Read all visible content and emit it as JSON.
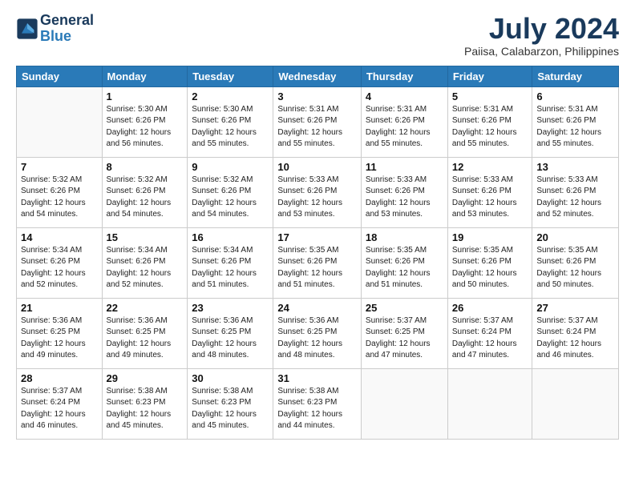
{
  "header": {
    "logo_line1": "General",
    "logo_line2": "Blue",
    "month": "July 2024",
    "location": "Paiisa, Calabarzon, Philippines"
  },
  "weekdays": [
    "Sunday",
    "Monday",
    "Tuesday",
    "Wednesday",
    "Thursday",
    "Friday",
    "Saturday"
  ],
  "weeks": [
    [
      {
        "day": "",
        "info": ""
      },
      {
        "day": "1",
        "info": "Sunrise: 5:30 AM\nSunset: 6:26 PM\nDaylight: 12 hours\nand 56 minutes."
      },
      {
        "day": "2",
        "info": "Sunrise: 5:30 AM\nSunset: 6:26 PM\nDaylight: 12 hours\nand 55 minutes."
      },
      {
        "day": "3",
        "info": "Sunrise: 5:31 AM\nSunset: 6:26 PM\nDaylight: 12 hours\nand 55 minutes."
      },
      {
        "day": "4",
        "info": "Sunrise: 5:31 AM\nSunset: 6:26 PM\nDaylight: 12 hours\nand 55 minutes."
      },
      {
        "day": "5",
        "info": "Sunrise: 5:31 AM\nSunset: 6:26 PM\nDaylight: 12 hours\nand 55 minutes."
      },
      {
        "day": "6",
        "info": "Sunrise: 5:31 AM\nSunset: 6:26 PM\nDaylight: 12 hours\nand 55 minutes."
      }
    ],
    [
      {
        "day": "7",
        "info": "Sunrise: 5:32 AM\nSunset: 6:26 PM\nDaylight: 12 hours\nand 54 minutes."
      },
      {
        "day": "8",
        "info": "Sunrise: 5:32 AM\nSunset: 6:26 PM\nDaylight: 12 hours\nand 54 minutes."
      },
      {
        "day": "9",
        "info": "Sunrise: 5:32 AM\nSunset: 6:26 PM\nDaylight: 12 hours\nand 54 minutes."
      },
      {
        "day": "10",
        "info": "Sunrise: 5:33 AM\nSunset: 6:26 PM\nDaylight: 12 hours\nand 53 minutes."
      },
      {
        "day": "11",
        "info": "Sunrise: 5:33 AM\nSunset: 6:26 PM\nDaylight: 12 hours\nand 53 minutes."
      },
      {
        "day": "12",
        "info": "Sunrise: 5:33 AM\nSunset: 6:26 PM\nDaylight: 12 hours\nand 53 minutes."
      },
      {
        "day": "13",
        "info": "Sunrise: 5:33 AM\nSunset: 6:26 PM\nDaylight: 12 hours\nand 52 minutes."
      }
    ],
    [
      {
        "day": "14",
        "info": "Sunrise: 5:34 AM\nSunset: 6:26 PM\nDaylight: 12 hours\nand 52 minutes."
      },
      {
        "day": "15",
        "info": "Sunrise: 5:34 AM\nSunset: 6:26 PM\nDaylight: 12 hours\nand 52 minutes."
      },
      {
        "day": "16",
        "info": "Sunrise: 5:34 AM\nSunset: 6:26 PM\nDaylight: 12 hours\nand 51 minutes."
      },
      {
        "day": "17",
        "info": "Sunrise: 5:35 AM\nSunset: 6:26 PM\nDaylight: 12 hours\nand 51 minutes."
      },
      {
        "day": "18",
        "info": "Sunrise: 5:35 AM\nSunset: 6:26 PM\nDaylight: 12 hours\nand 51 minutes."
      },
      {
        "day": "19",
        "info": "Sunrise: 5:35 AM\nSunset: 6:26 PM\nDaylight: 12 hours\nand 50 minutes."
      },
      {
        "day": "20",
        "info": "Sunrise: 5:35 AM\nSunset: 6:26 PM\nDaylight: 12 hours\nand 50 minutes."
      }
    ],
    [
      {
        "day": "21",
        "info": "Sunrise: 5:36 AM\nSunset: 6:25 PM\nDaylight: 12 hours\nand 49 minutes."
      },
      {
        "day": "22",
        "info": "Sunrise: 5:36 AM\nSunset: 6:25 PM\nDaylight: 12 hours\nand 49 minutes."
      },
      {
        "day": "23",
        "info": "Sunrise: 5:36 AM\nSunset: 6:25 PM\nDaylight: 12 hours\nand 48 minutes."
      },
      {
        "day": "24",
        "info": "Sunrise: 5:36 AM\nSunset: 6:25 PM\nDaylight: 12 hours\nand 48 minutes."
      },
      {
        "day": "25",
        "info": "Sunrise: 5:37 AM\nSunset: 6:25 PM\nDaylight: 12 hours\nand 47 minutes."
      },
      {
        "day": "26",
        "info": "Sunrise: 5:37 AM\nSunset: 6:24 PM\nDaylight: 12 hours\nand 47 minutes."
      },
      {
        "day": "27",
        "info": "Sunrise: 5:37 AM\nSunset: 6:24 PM\nDaylight: 12 hours\nand 46 minutes."
      }
    ],
    [
      {
        "day": "28",
        "info": "Sunrise: 5:37 AM\nSunset: 6:24 PM\nDaylight: 12 hours\nand 46 minutes."
      },
      {
        "day": "29",
        "info": "Sunrise: 5:38 AM\nSunset: 6:23 PM\nDaylight: 12 hours\nand 45 minutes."
      },
      {
        "day": "30",
        "info": "Sunrise: 5:38 AM\nSunset: 6:23 PM\nDaylight: 12 hours\nand 45 minutes."
      },
      {
        "day": "31",
        "info": "Sunrise: 5:38 AM\nSunset: 6:23 PM\nDaylight: 12 hours\nand 44 minutes."
      },
      {
        "day": "",
        "info": ""
      },
      {
        "day": "",
        "info": ""
      },
      {
        "day": "",
        "info": ""
      }
    ]
  ]
}
